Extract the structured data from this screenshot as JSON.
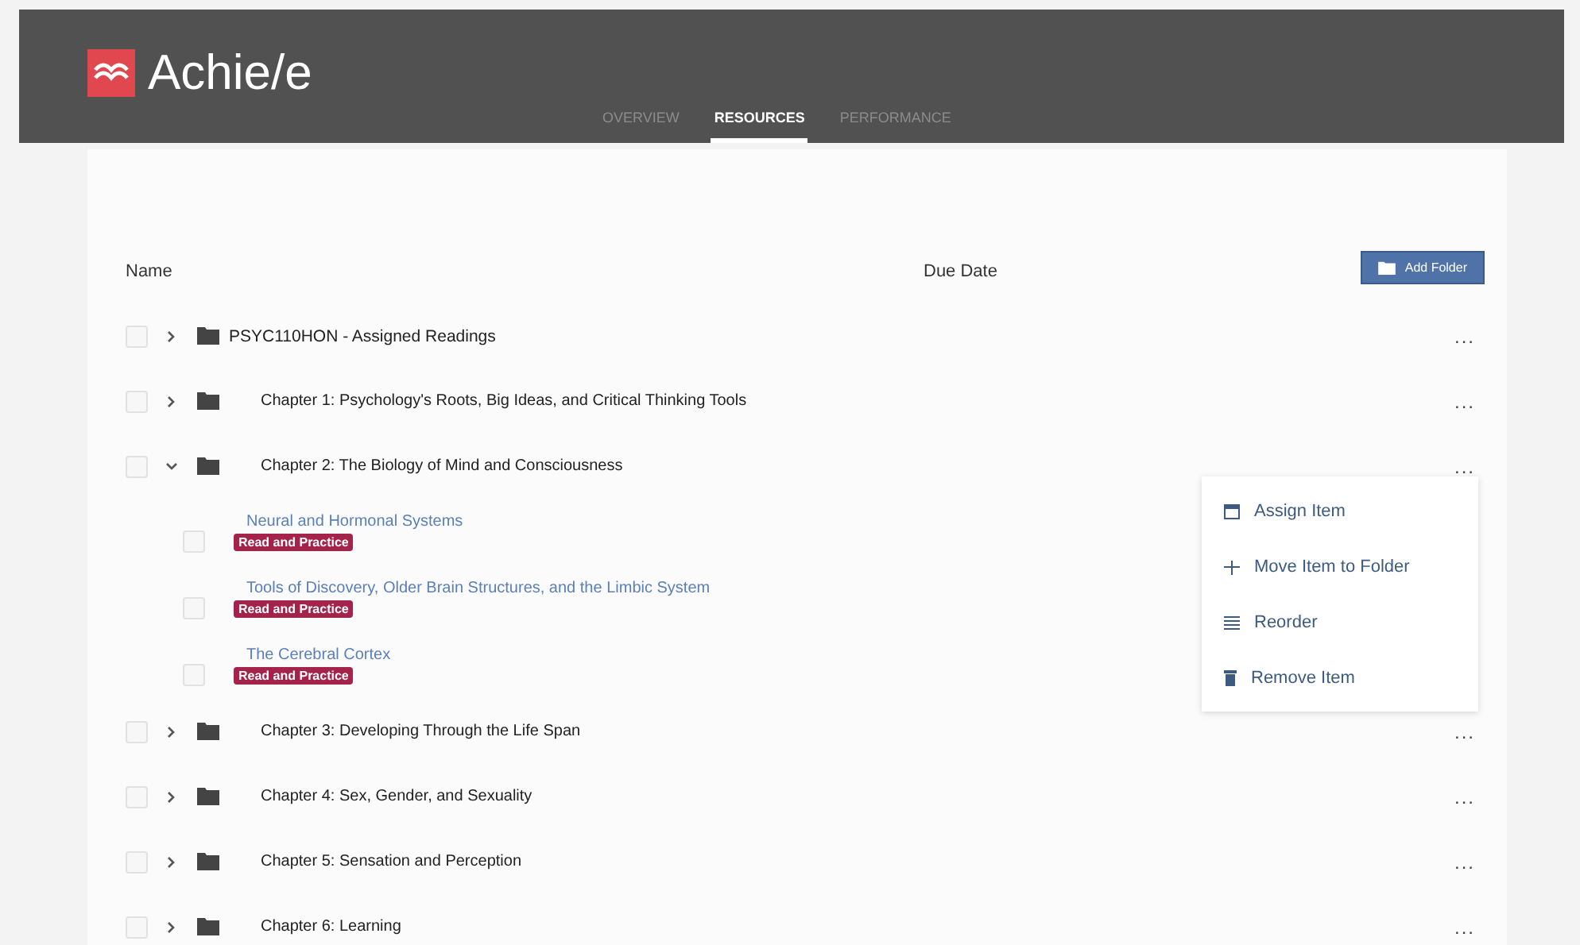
{
  "header": {
    "logo_text": "Achie/e",
    "tabs": [
      {
        "label": "OVERVIEW",
        "selected": false
      },
      {
        "label": "RESOURCES",
        "selected": true
      },
      {
        "label": "PERFORMANCE",
        "selected": false
      }
    ]
  },
  "toolbar": {
    "add_folder": "Add Folder"
  },
  "table": {
    "columns": [
      "Name",
      "Due Date"
    ],
    "rows": [
      {
        "kind": "course",
        "title": "PSYC110HON - Assigned Readings",
        "checked": false,
        "expanded": false,
        "more": "..."
      },
      {
        "kind": "chapter",
        "title": "Chapter 1: Psychology's Roots, Big Ideas, and Critical Thinking Tools",
        "checked": false,
        "expanded": false,
        "more": "..."
      },
      {
        "kind": "chapter",
        "title": "Chapter 2: The Biology of Mind and Consciousness",
        "checked": false,
        "expanded": true,
        "more": "...",
        "children": [
          {
            "title": "Neural and Hormonal Systems",
            "checked": false,
            "tag": "Read and Practice"
          },
          {
            "title": "Tools of Discovery, Older Brain Structures, and the Limbic System",
            "checked": false,
            "tag": "Read and Practice"
          },
          {
            "title": "The Cerebral Cortex",
            "checked": false,
            "tag": "Read and Practice"
          }
        ]
      },
      {
        "kind": "chapter",
        "title": "Chapter 3: Developing Through the Life Span",
        "checked": false,
        "expanded": false,
        "more": "..."
      },
      {
        "kind": "chapter",
        "title": "Chapter 4: Sex, Gender, and Sexuality",
        "checked": false,
        "expanded": false,
        "more": "..."
      },
      {
        "kind": "chapter",
        "title": "Chapter 5: Sensation and Perception",
        "checked": false,
        "expanded": false,
        "more": "..."
      },
      {
        "kind": "chapter",
        "title": "Chapter 6: Learning",
        "checked": false,
        "expanded": false,
        "more": "..."
      }
    ]
  },
  "context_menu": {
    "items": [
      {
        "kind": "assign",
        "label": "Assign Item"
      },
      {
        "kind": "move",
        "label": "Move Item to Folder"
      },
      {
        "kind": "reorder",
        "label": "Reorder"
      },
      {
        "kind": "remove",
        "label": "Remove Item"
      }
    ]
  }
}
